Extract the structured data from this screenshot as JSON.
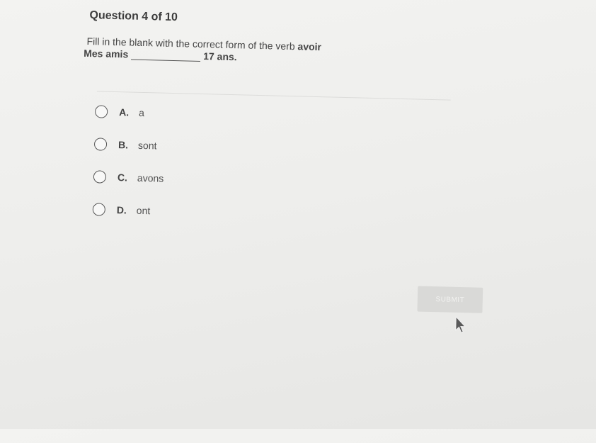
{
  "question": {
    "header": "Question 4 of 10",
    "prompt_prefix": "Fill in the blank with the correct form of the verb",
    "prompt_verb": "avoir",
    "sentence_start": "Mes amis",
    "sentence_end": "17 ans."
  },
  "choices": [
    {
      "letter": "A.",
      "text": "a"
    },
    {
      "letter": "B.",
      "text": "sont"
    },
    {
      "letter": "C.",
      "text": "avons"
    },
    {
      "letter": "D.",
      "text": "ont"
    }
  ],
  "submit_label": "SUBMIT",
  "icons": {
    "radio": "radio-button-unselected-icon",
    "cursor": "mouse-pointer-icon"
  },
  "colors": {
    "submit_bg": "#d9d9d7",
    "text": "#3a3a3a"
  }
}
